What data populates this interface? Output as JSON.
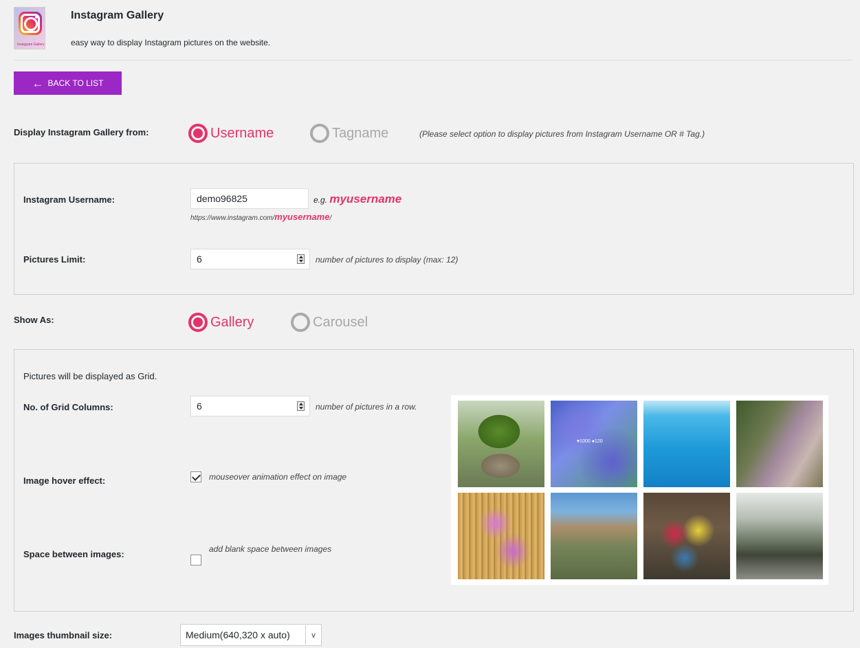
{
  "header": {
    "title": "Instagram Gallery",
    "subtitle": "easy way to display Instagram pictures on the website.",
    "logo_caption": "Instagram Gallery"
  },
  "back_button": {
    "label": "BACK TO LIST",
    "icon": "arrow-left-icon"
  },
  "source": {
    "label": "Display Instagram Gallery from:",
    "options": [
      {
        "label": "Username",
        "selected": true
      },
      {
        "label": "Tagname",
        "selected": false
      }
    ],
    "hint": "(Please select option to display pictures from Instagram Username OR # Tag.)"
  },
  "username_section": {
    "username_label": "Instagram Username:",
    "username_value": "demo96825",
    "example_prefix": "e.g.",
    "example_value": "myusername",
    "url_prefix": "https://www.instagram.com/",
    "url_user": "myusername",
    "url_suffix": "/",
    "limit_label": "Pictures Limit:",
    "limit_value": "6",
    "limit_hint": "number of pictures to display (max: 12)"
  },
  "show_as": {
    "label": "Show As:",
    "options": [
      {
        "label": "Gallery",
        "selected": true
      },
      {
        "label": "Carousel",
        "selected": false
      }
    ]
  },
  "grid_section": {
    "intro": "Pictures will be displayed as Grid.",
    "columns_label": "No. of Grid Columns:",
    "columns_value": "6",
    "columns_hint": "number of pictures in a row.",
    "hover_label": "Image hover effect:",
    "hover_checked": true,
    "hover_hint": "mouseover animation effect on image",
    "space_label": "Space between images:",
    "space_checked": false,
    "space_hint": "add blank space between images",
    "preview_overlay": {
      "likes": "1000",
      "comments": "120"
    }
  },
  "thumbnail": {
    "label": "Images thumbnail size:",
    "selected": "Medium(640,320 x auto)"
  },
  "colors": {
    "accent": "#e2346a",
    "button": "#9b27c5",
    "background": "#f1f1f1"
  }
}
